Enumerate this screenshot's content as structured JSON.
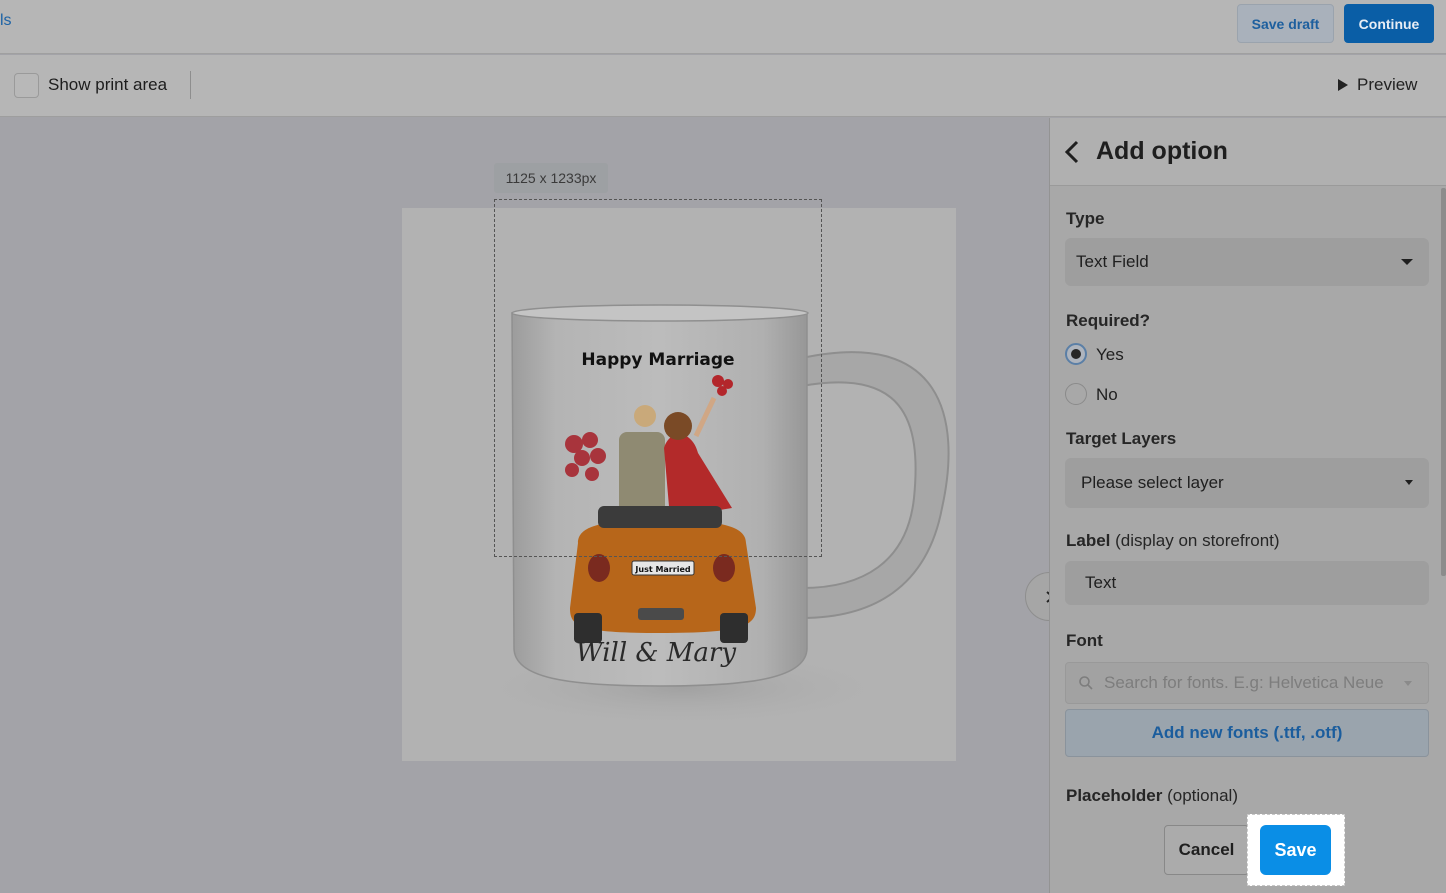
{
  "header": {
    "crumb_fragment": "ls",
    "save_draft_label": "Save draft",
    "continue_label": "Continue"
  },
  "toolbar": {
    "show_print_area_label": "Show print area",
    "show_print_area_checked": false,
    "preview_label": "Preview"
  },
  "canvas": {
    "dimension_badge": "1125 x 1233px",
    "design_title": "Happy Marriage",
    "plate_text": "Just Married",
    "names_text": "Will & Mary"
  },
  "panel": {
    "title": "Add option",
    "type_label": "Type",
    "type_value": "Text Field",
    "required_label": "Required?",
    "required_options": [
      "Yes",
      "No"
    ],
    "required_selected": "Yes",
    "target_layers_label": "Target Layers",
    "target_layers_placeholder": "Please select layer",
    "label_label": "Label",
    "label_hint": "(display on storefront)",
    "label_value": "Text",
    "font_label": "Font",
    "font_search_placeholder": "Search for fonts. E.g: Helvetica Neue",
    "add_fonts_label": "Add new fonts (.ttf, .otf)",
    "placeholder_label": "Placeholder",
    "placeholder_hint": "(optional)",
    "cancel_label": "Cancel",
    "save_label": "Save"
  },
  "colors": {
    "accent": "#0a8ee6",
    "link": "#1d63a6",
    "continue": "#0a5ea6"
  }
}
